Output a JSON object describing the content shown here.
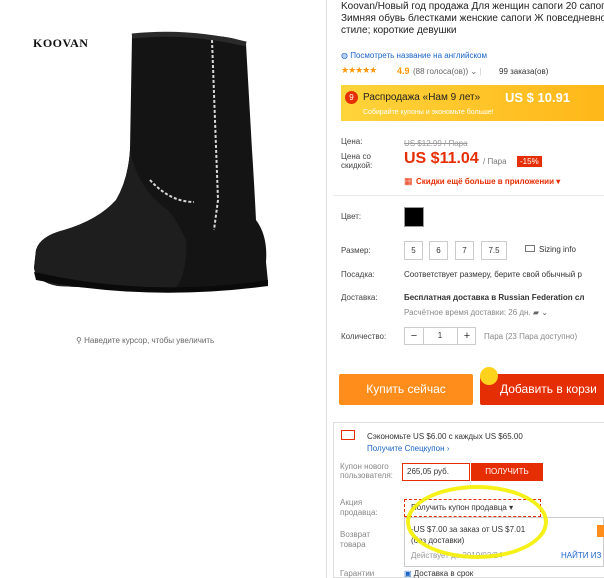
{
  "brand": "KOOVAN",
  "zoom_hint": "Наведите курсор, чтобы увеличить",
  "product": {
    "title": "Koovan/Новый год продажа Для женщин сапоги 20 сапоги Зимняя обувь блестками женские сапоги Ж повседневном стиле; короткие девушки",
    "translate_link": "Посмотреть название на английском",
    "stars": "★★★★★",
    "rating": "4.9",
    "votes": "(88 голоса(ов))",
    "orders": "99 заказа(ов)"
  },
  "promo": {
    "text": "Распродажа «Нам 9 лет»",
    "price": "US $ 10.91",
    "sub": "Собирайте купоны и экономьте больше!"
  },
  "pricing": {
    "price_label": "Цена:",
    "old_price": "US $12.99 / Пара",
    "discount_label": "Цена со скидкой:",
    "new_price": "US $11.04",
    "unit": "/ Пара",
    "discount": "-15%",
    "app_discount": "Скидки ещё больше в приложении"
  },
  "options": {
    "color_label": "Цвет:",
    "size_label": "Размер:",
    "sizes": [
      "5",
      "6",
      "7",
      "7.5"
    ],
    "sizing_info": "Sizing info",
    "fit_label": "Посадка:",
    "fit_value": "Соответствует размеру, берите свой обычный р",
    "shipping_label": "Доставка:",
    "shipping_value": "Бесплатная доставка в Russian Federation сл",
    "shipping_time": "Расчётное время доставки: 26 дн.",
    "qty_label": "Количество:",
    "qty_value": "1",
    "qty_stock": "Пара (23 Пара доступно)"
  },
  "actions": {
    "buy_now": "Купить сейчас",
    "add_to_cart": "Добавить в корзи"
  },
  "coupons": {
    "save_text": "Сэкономьте US $6.00 с каждых US $65.00",
    "special_coupon": "Получите Спецкупон",
    "new_user_label": "Купон нового пользователя:",
    "new_user_value": "265,05 руб.",
    "get_button": "ПОЛУЧИТЬ",
    "seller_label": "Акция продавца:",
    "seller_dropdown": "Получить купон продавца",
    "offer": "-US $7.00 за заказ от US $7.01",
    "offer_note": "(без доставки)",
    "valid_until": "Действует до 2019/03/24",
    "find_link": "НАЙТИ ИЗ",
    "return_label": "Возврат товара",
    "guarantee_label": "Гарантии",
    "guarantee_value": "Доставка в срок"
  },
  "colors": {
    "accent": "#e62e04",
    "orange": "#ff8d1b",
    "link": "#1b64c8"
  }
}
